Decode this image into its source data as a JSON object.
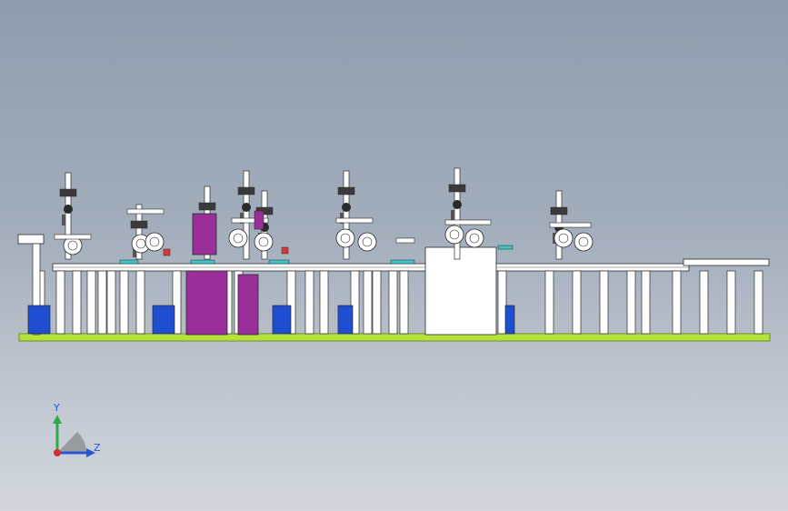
{
  "viewport": {
    "background_top": "#8e9cae",
    "background_bottom": "#d3d7dd"
  },
  "model": {
    "base_color": "#b4e23c",
    "frame_color": "#ffffff",
    "line_color": "#2a2a2a",
    "accent_magenta": "#9a2f9a",
    "accent_blue": "#1f4fd0",
    "accent_cyan": "#3bc6c6",
    "accent_red": "#d23a3a"
  },
  "triad": {
    "y_label": "Y",
    "z_label": "Z",
    "y_color": "#2fa84a",
    "z_color": "#2a55d6",
    "x_color": "#d23030",
    "label_color": "#2a55d6"
  }
}
